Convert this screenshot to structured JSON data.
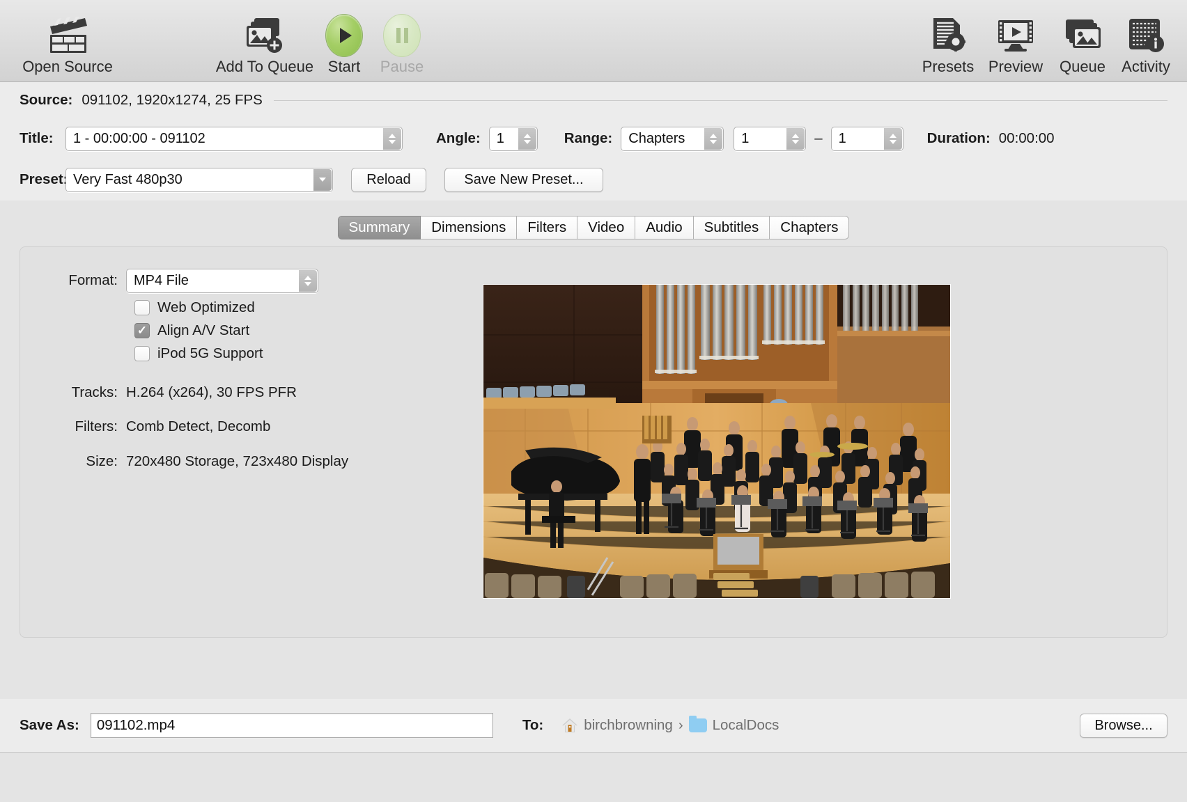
{
  "toolbar": {
    "items": [
      {
        "label": "Open Source",
        "icon": "clapperboard-icon",
        "name": "open-source"
      },
      {
        "label": "Add To Queue",
        "icon": "add-to-queue-icon",
        "name": "add-to-queue"
      },
      {
        "label": "Start",
        "icon": "play-icon",
        "name": "start"
      },
      {
        "label": "Pause",
        "icon": "pause-icon",
        "name": "pause",
        "disabled": true
      },
      {
        "label": "Presets",
        "icon": "presets-icon",
        "name": "presets"
      },
      {
        "label": "Preview",
        "icon": "preview-monitor-icon",
        "name": "preview"
      },
      {
        "label": "Queue",
        "icon": "queue-stack-icon",
        "name": "queue"
      },
      {
        "label": "Activity",
        "icon": "activity-log-icon",
        "name": "activity"
      }
    ]
  },
  "source": {
    "label": "Source:",
    "value": "091102, 1920x1274, 25 FPS"
  },
  "title_row": {
    "title_label": "Title:",
    "title_value": "1 - 00:00:00 - 091102",
    "angle_label": "Angle:",
    "angle_value": "1",
    "range_label": "Range:",
    "range_value": "Chapters",
    "range_start": "1",
    "range_dash": "–",
    "range_end": "1",
    "duration_label": "Duration:",
    "duration_value": "00:00:00"
  },
  "preset_row": {
    "preset_label": "Preset:",
    "preset_value": "Very Fast 480p30",
    "reload_label": "Reload",
    "save_new_preset_label": "Save New Preset..."
  },
  "tabs": [
    {
      "label": "Summary",
      "active": true
    },
    {
      "label": "Dimensions",
      "active": false
    },
    {
      "label": "Filters",
      "active": false
    },
    {
      "label": "Video",
      "active": false
    },
    {
      "label": "Audio",
      "active": false
    },
    {
      "label": "Subtitles",
      "active": false
    },
    {
      "label": "Chapters",
      "active": false
    }
  ],
  "summary": {
    "format_label": "Format:",
    "format_value": "MP4 File",
    "checkboxes": [
      {
        "label": "Web Optimized",
        "checked": false
      },
      {
        "label": "Align A/V Start",
        "checked": true
      },
      {
        "label": "iPod 5G Support",
        "checked": false
      }
    ],
    "tracks_label": "Tracks:",
    "tracks_value": "H.264 (x264), 30 FPS PFR",
    "filters_label": "Filters:",
    "filters_value": "Comb Detect, Decomb",
    "size_label": "Size:",
    "size_value": "720x480 Storage, 723x480 Display",
    "preview_alt": "concert hall stage with orchestra and organ pipes"
  },
  "destination": {
    "save_as_label": "Save As:",
    "save_as_value": "091102.mp4",
    "save_as_placeholder": "",
    "to_label": "To:",
    "home_name": "birchbrowning",
    "separator": "›",
    "folder_name": "LocalDocs",
    "browse_label": "Browse..."
  },
  "colors": {
    "start_green": "#a4ce65",
    "tab_active": "#9a9a9a",
    "folder_blue": "#8fcdf2",
    "window_bg": "#ececec"
  }
}
